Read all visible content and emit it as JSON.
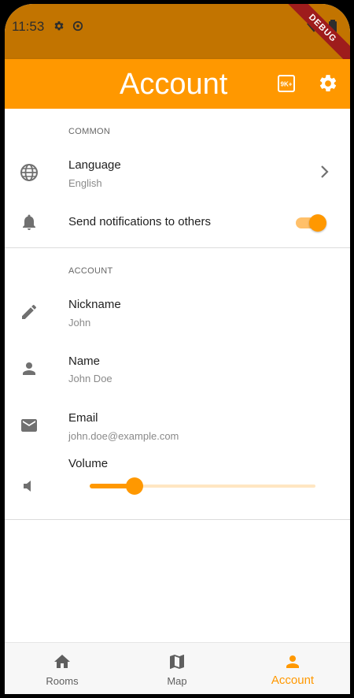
{
  "status_bar": {
    "time": "11:53",
    "debug_label": "DEBUG"
  },
  "app_bar": {
    "title": "Account",
    "actions": [
      "9k-plus-icon",
      "settings-icon"
    ]
  },
  "sections": {
    "common": {
      "header": "COMMON",
      "language": {
        "title": "Language",
        "value": "English"
      },
      "notifications": {
        "title": "Send notifications to others",
        "enabled": true
      }
    },
    "account": {
      "header": "ACCOUNT",
      "nickname": {
        "title": "Nickname",
        "value": "John"
      },
      "name": {
        "title": "Name",
        "value": "John Doe"
      },
      "email": {
        "title": "Email",
        "value": "john.doe@example.com"
      },
      "volume": {
        "title": "Volume",
        "level": 0.2
      }
    }
  },
  "bottom_nav": {
    "items": [
      {
        "label": "Rooms",
        "icon": "home-icon"
      },
      {
        "label": "Map",
        "icon": "map-icon"
      },
      {
        "label": "Account",
        "icon": "person-icon",
        "active": true
      }
    ]
  },
  "colors": {
    "accent": "#ff9800",
    "status_bar": "#c27400",
    "debug_ribbon": "#9e1c1c"
  }
}
